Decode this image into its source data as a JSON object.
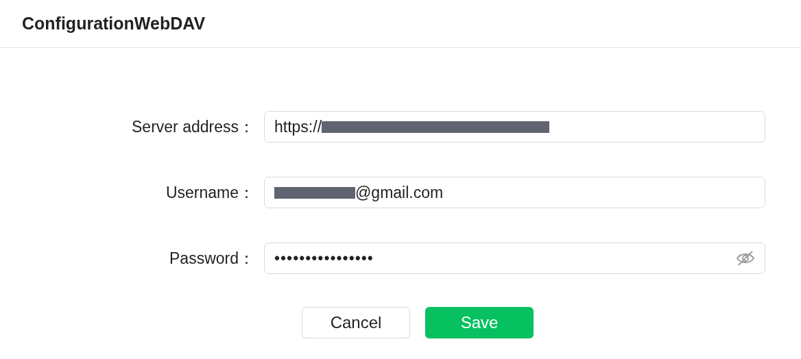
{
  "dialog": {
    "title": "ConfigurationWebDAV"
  },
  "fields": [
    {
      "kind": "text",
      "label": "Server address：",
      "before": "https://",
      "redacted": true
    },
    {
      "kind": "text",
      "label": "Username：",
      "redacted": true,
      "after": "@gmail.com"
    },
    {
      "kind": "password",
      "label": "Password：",
      "before": "••••••••••••••••",
      "redacted": false
    }
  ],
  "buttons": [
    {
      "kind": "secondary",
      "label": "Cancel"
    },
    {
      "kind": "primary",
      "label": "Save"
    }
  ]
}
